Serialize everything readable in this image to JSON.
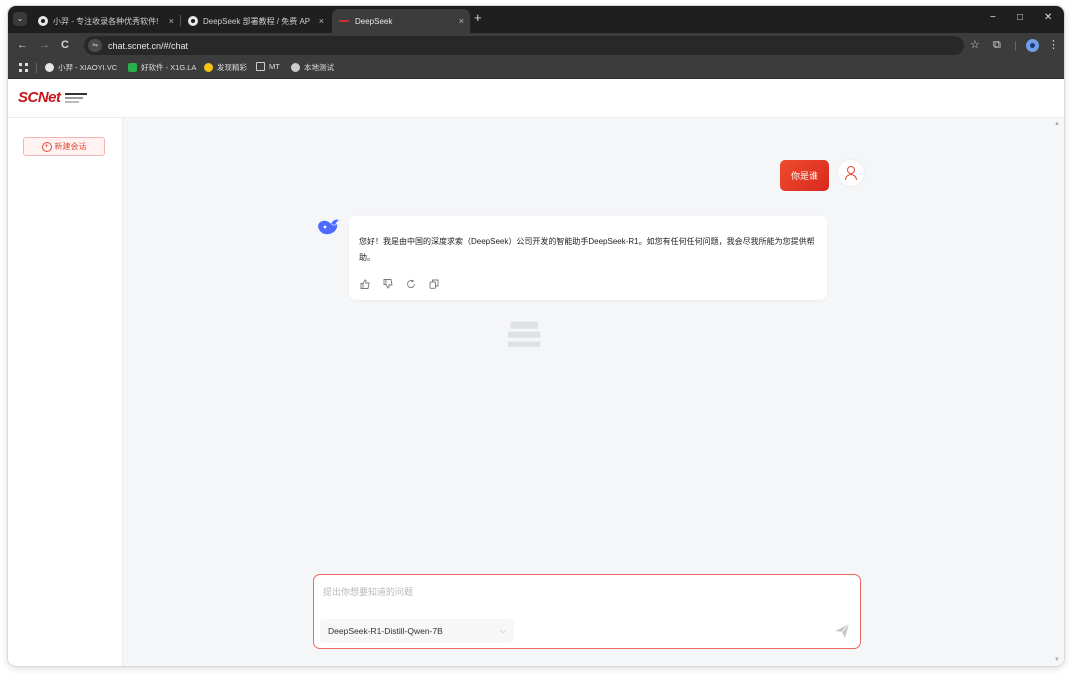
{
  "browser": {
    "menu_icon": "chevron-down",
    "tabs": [
      {
        "title": "小羿 - 专注收录各种优秀软件!",
        "icon": "site-logo-icon"
      },
      {
        "title": "DeepSeek 部署教程 / 免费 AP",
        "icon": "site-logo-icon"
      },
      {
        "title": "DeepSeek",
        "icon": "deepseek-favicon-icon",
        "active": true
      }
    ],
    "close_glyph": "×",
    "new_tab_glyph": "+",
    "window_controls": {
      "minimize": "−",
      "maximize": "□",
      "close": "✕"
    },
    "nav": {
      "back": "←",
      "forward": "→",
      "reload": "C"
    },
    "url": "chat.scnet.cn/#/chat",
    "bookmarks": [
      {
        "label": "小羿 - XIAOYI.VC",
        "color": "#e6e6e6"
      },
      {
        "label": "好软件 - X1G.LA",
        "color": "#29b04d"
      },
      {
        "label": "发现精彩",
        "color": "#f5c518"
      },
      {
        "label": "MT",
        "color": "#cccccc"
      },
      {
        "label": "本地测试",
        "color": "#cccccc"
      }
    ]
  },
  "site": {
    "logo_text": "SCNet",
    "new_chat_label": "新建会话"
  },
  "chat": {
    "user_message": "你是谁",
    "assistant_message": "您好！我是由中国的深度求索（DeepSeek）公司开发的智能助手DeepSeek-R1。如您有任何任何问题，我会尽我所能为您提供帮助。",
    "actions": [
      "thumbs-up-icon",
      "thumbs-down-icon",
      "regenerate-icon",
      "copy-icon"
    ],
    "input_placeholder": "提出你想要知道的问题",
    "model": "DeepSeek-R1-Distill-Qwen-7B"
  },
  "colors": {
    "brand": "#c8161d",
    "accent": "#e24a3b",
    "user_bubble": "#e43a26"
  }
}
